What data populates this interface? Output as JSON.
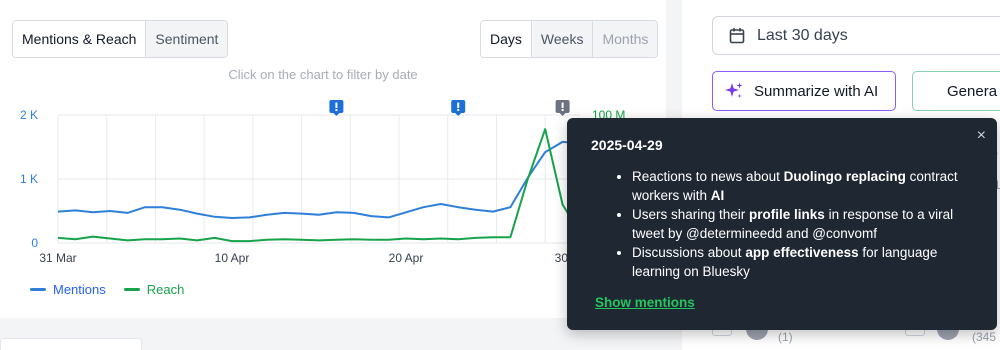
{
  "tabs": [
    {
      "label": "Mentions & Reach",
      "active": true
    },
    {
      "label": "Sentiment",
      "active": false
    }
  ],
  "granularity": [
    {
      "label": "Days",
      "active": true
    },
    {
      "label": "Weeks",
      "active": false
    },
    {
      "label": "Months",
      "active": false,
      "disabled": true
    }
  ],
  "chart_hint": "Click on the chart to filter by date",
  "chart_data": {
    "type": "line",
    "x_ticks": [
      "31 Mar",
      "10 Apr",
      "20 Apr",
      "30"
    ],
    "y_left_ticks": [
      "2 K",
      "1 K",
      "0"
    ],
    "y_right_ticks": [
      "100 M"
    ],
    "ylim_left": [
      0,
      2000
    ],
    "ylim_right": [
      0,
      100000000
    ],
    "grid": true,
    "x_days": [
      31,
      32,
      33,
      34,
      35,
      36,
      37,
      38,
      39,
      40,
      41,
      42,
      43,
      44,
      45,
      46,
      47,
      48,
      49,
      50,
      51,
      52,
      53,
      54,
      55,
      56,
      57,
      58,
      59,
      60,
      61
    ],
    "series": [
      {
        "name": "Mentions",
        "axis": "left",
        "color": "#2e7fd9",
        "values": [
          490,
          510,
          480,
          500,
          470,
          560,
          560,
          520,
          460,
          410,
          390,
          400,
          440,
          470,
          460,
          440,
          480,
          470,
          420,
          400,
          480,
          560,
          610,
          560,
          520,
          490,
          560,
          1020,
          1420,
          1580,
          1560
        ]
      },
      {
        "name": "Reach",
        "axis": "right",
        "color": "#16a34a",
        "values": [
          4000000,
          3000000,
          5000000,
          3500000,
          2000000,
          3000000,
          3000000,
          3500000,
          2000000,
          4000000,
          1500000,
          1500000,
          2500000,
          3000000,
          2500000,
          2000000,
          2500000,
          3000000,
          2500000,
          2500000,
          3500000,
          3000000,
          3500000,
          3000000,
          4000000,
          4500000,
          4500000,
          50000000,
          89000000,
          30000000,
          8000000
        ]
      }
    ],
    "markers": [
      {
        "day": 47,
        "type": "alert",
        "color": "#1e6fd9"
      },
      {
        "day": 54,
        "type": "alert",
        "color": "#1e6fd9"
      },
      {
        "day": 60,
        "type": "alert",
        "color": "#6b7280"
      }
    ]
  },
  "legend": [
    {
      "label": "Mentions",
      "color": "#2e7fd9"
    },
    {
      "label": "Reach",
      "color": "#16a34a"
    }
  ],
  "right": {
    "date_range": "Last 30 days",
    "summarize_label": "Summarize with AI",
    "generate_label": "Genera",
    "peek": [
      "S",
      "(1",
      "(",
      "(1)",
      "(345"
    ]
  },
  "popup": {
    "date": "2025-04-29",
    "items": [
      [
        "Reactions to news about ",
        "Duolingo replacing",
        " contract workers with ",
        "AI",
        ""
      ],
      [
        "Users sharing their ",
        "profile links",
        " in response to a viral tweet by @determineedd and @convomf",
        "",
        ""
      ],
      [
        "Discussions about ",
        "app effectiveness",
        " for language learning on Bluesky",
        "",
        ""
      ]
    ],
    "link": "Show mentions",
    "close": "×"
  }
}
